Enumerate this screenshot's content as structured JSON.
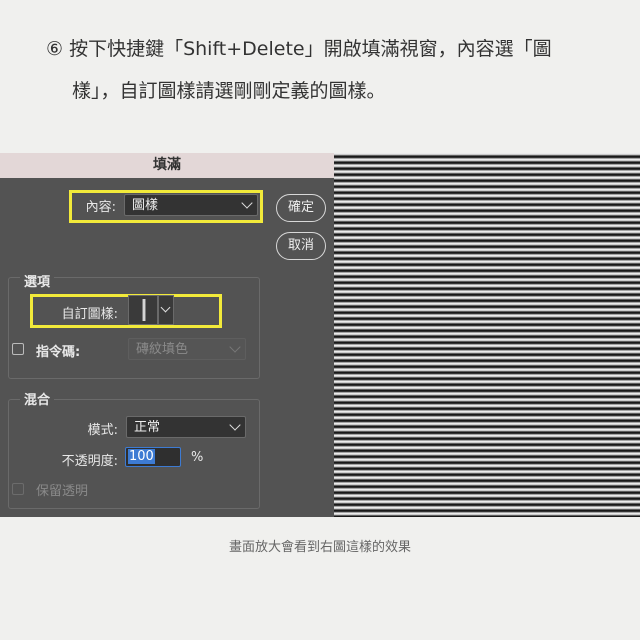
{
  "instruction": {
    "line1": "⑥ 按下快捷鍵「Shift+Delete」開啟填滿視窗，內容選「圖",
    "line2": "樣」，自訂圖樣請選剛剛定義的圖樣。"
  },
  "dialog": {
    "title": "填滿",
    "content_label": "內容:",
    "content_value": "圖樣",
    "ok_button": "確定",
    "cancel_button": "取消",
    "options": {
      "heading": "選項",
      "custom_pattern_label": "自訂圖樣:",
      "script_label": "指令碼:",
      "script_value": "磚紋填色",
      "script_checked": false
    },
    "blending": {
      "heading": "混合",
      "mode_label": "模式:",
      "mode_value": "正常",
      "opacity_label": "不透明度:",
      "opacity_value": "100",
      "opacity_unit": "%",
      "preserve_label": "保留透明",
      "preserve_checked": false
    }
  },
  "caption": "畫面放大會看到右圖這樣的效果",
  "colors": {
    "highlight": "#f2ea3a",
    "dialog_bg": "#535353",
    "titlebar_bg": "#e3d7d7",
    "focus_blue": "#3d7bd3"
  }
}
